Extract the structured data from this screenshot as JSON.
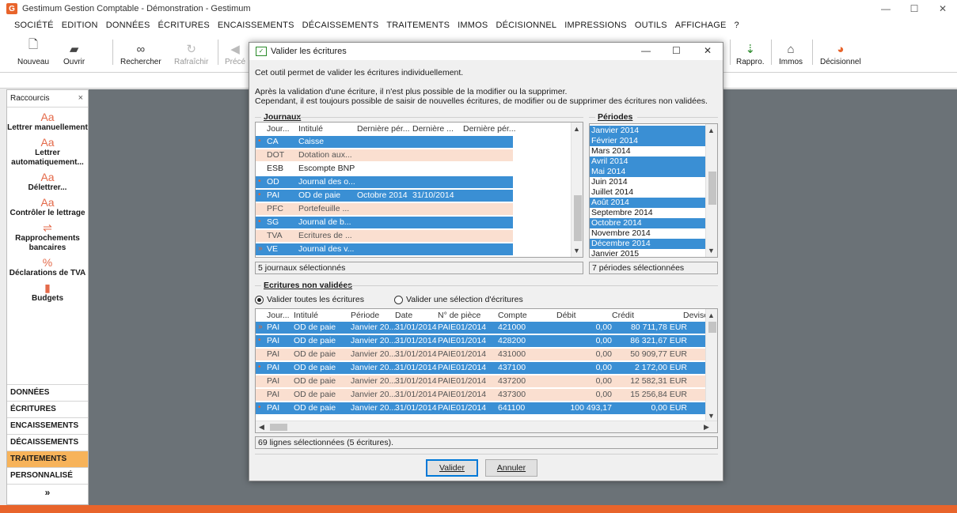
{
  "app": {
    "title": "Gestimum Gestion Comptable - Démonstration - Gestimum",
    "logo_letter": "G"
  },
  "window_controls": {
    "minimize": "—",
    "maximize": "☐",
    "close": "✕"
  },
  "menu": [
    "SOCIÉTÉ",
    "EDITION",
    "DONNÉES",
    "ÉCRITURES",
    "ENCAISSEMENTS",
    "DÉCAISSEMENTS",
    "TRAITEMENTS",
    "IMMOS",
    "DÉCISIONNEL",
    "IMPRESSIONS",
    "OUTILS",
    "AFFICHAGE",
    "?"
  ],
  "toolbar": {
    "nouveau": "Nouveau",
    "ouvrir": "Ouvrir",
    "rechercher": "Rechercher",
    "rafraichir": "Rafraîchir",
    "precedent": "Précé",
    "rappro": "Rappro.",
    "immos": "Immos",
    "decisionnel": "Décisionnel"
  },
  "left_panel": {
    "header": "Raccourcis",
    "close": "×",
    "shortcuts": [
      {
        "label": "Lettrer manuellement",
        "icon": "Aa"
      },
      {
        "label": "Lettrer automatiquement...",
        "icon": "Aa"
      },
      {
        "label": "Délettrer...",
        "icon": "Aa"
      },
      {
        "label": "Contrôler le lettrage",
        "icon": "Aa"
      },
      {
        "label": "Rapprochements bancaires",
        "icon": "⇌"
      },
      {
        "label": "Déclarations de TVA",
        "icon": "%"
      },
      {
        "label": "Budgets",
        "icon": "▮"
      }
    ],
    "nav": [
      "DONNÉES",
      "ÉCRITURES",
      "ENCAISSEMENTS",
      "DÉCAISSEMENTS",
      "TRAITEMENTS",
      "PERSONNALISÉ"
    ],
    "active_nav": "TRAITEMENTS",
    "more": "»"
  },
  "dialog": {
    "title": "Valider les écritures",
    "intro1": "Cet outil permet de valider les écritures individuellement.",
    "intro2": "Après la validation d'une écriture, il n'est plus possible de la modifier ou la supprimer.",
    "intro3": "Cependant, il est toujours possible de saisir de nouvelles écritures, de modifier ou de supprimer des écritures non validées.",
    "journaux": {
      "title": "Journaux",
      "columns": [
        "Jour...",
        "Intitulé",
        "Dernière pér...",
        "Dernière ...",
        "Dernière pér..."
      ],
      "rows": [
        {
          "code": "CA",
          "label": "Caisse",
          "p1": "",
          "p2": "",
          "state": "sel",
          "dot": "•"
        },
        {
          "code": "DOT",
          "label": "Dotation aux...",
          "p1": "",
          "p2": "",
          "state": "pink",
          "dot": ""
        },
        {
          "code": "ESB",
          "label": "Escompte BNP",
          "p1": "",
          "p2": "",
          "state": "white",
          "dot": ""
        },
        {
          "code": "OD",
          "label": "Journal des o...",
          "p1": "",
          "p2": "",
          "state": "sel",
          "dot": "•"
        },
        {
          "code": "PAI",
          "label": "OD de paie",
          "p1": "Octobre 2014",
          "p2": "31/10/2014",
          "state": "sel",
          "dot": "•"
        },
        {
          "code": "PFC",
          "label": "Portefeuille ...",
          "p1": "",
          "p2": "",
          "state": "pink",
          "dot": ""
        },
        {
          "code": "SG",
          "label": "Journal de b...",
          "p1": "",
          "p2": "",
          "state": "sel",
          "dot": "•"
        },
        {
          "code": "TVA",
          "label": "Ecritures de ...",
          "p1": "",
          "p2": "",
          "state": "pink",
          "dot": ""
        },
        {
          "code": "VE",
          "label": "Journal des v...",
          "p1": "",
          "p2": "",
          "state": "sel",
          "dot": "»"
        }
      ],
      "count": "5 journaux sélectionnés"
    },
    "periodes": {
      "title": "Périodes",
      "rows": [
        {
          "label": "Janvier 2014",
          "state": "sel"
        },
        {
          "label": "Février 2014",
          "state": "sel"
        },
        {
          "label": "Mars 2014",
          "state": "white"
        },
        {
          "label": "Avril 2014",
          "state": "sel"
        },
        {
          "label": "Mai 2014",
          "state": "sel"
        },
        {
          "label": "Juin 2014",
          "state": "white"
        },
        {
          "label": "Juillet 2014",
          "state": "white"
        },
        {
          "label": "Août 2014",
          "state": "sel"
        },
        {
          "label": "Septembre 2014",
          "state": "white"
        },
        {
          "label": "Octobre 2014",
          "state": "sel"
        },
        {
          "label": "Novembre 2014",
          "state": "white"
        },
        {
          "label": "Décembre 2014",
          "state": "sel"
        },
        {
          "label": "Janvier 2015",
          "state": "white"
        }
      ],
      "count": "7 périodes sélectionnées"
    },
    "ecritures": {
      "title": "Ecritures non validées",
      "radio_all": "Valider toutes les écritures",
      "radio_selection": "Valider une sélection d'écritures",
      "columns": [
        "Jour...",
        "Intitulé",
        "Période",
        "Date",
        "N° de pièce",
        "Compte",
        "Débit",
        "Crédit",
        "Devise"
      ],
      "rows": [
        {
          "dot": "»",
          "j": "PAI",
          "intitule": "OD de paie",
          "periode": "Janvier 20...",
          "date": "31/01/2014",
          "piece": "PAIE01/2014",
          "compte": "421000",
          "debit": "0,00",
          "credit": "80 711,78 EUR",
          "state": "sel"
        },
        {
          "dot": "•",
          "j": "PAI",
          "intitule": "OD de paie",
          "periode": "Janvier 20...",
          "date": "31/01/2014",
          "piece": "PAIE01/2014",
          "compte": "428200",
          "debit": "0,00",
          "credit": "86 321,67 EUR",
          "state": "sel"
        },
        {
          "dot": "",
          "j": "PAI",
          "intitule": "OD de paie",
          "periode": "Janvier 20...",
          "date": "31/01/2014",
          "piece": "PAIE01/2014",
          "compte": "431000",
          "debit": "0,00",
          "credit": "50 909,77 EUR",
          "state": "pink"
        },
        {
          "dot": "•",
          "j": "PAI",
          "intitule": "OD de paie",
          "periode": "Janvier 20...",
          "date": "31/01/2014",
          "piece": "PAIE01/2014",
          "compte": "437100",
          "debit": "0,00",
          "credit": "2 172,00 EUR",
          "state": "sel"
        },
        {
          "dot": "",
          "j": "PAI",
          "intitule": "OD de paie",
          "periode": "Janvier 20...",
          "date": "31/01/2014",
          "piece": "PAIE01/2014",
          "compte": "437200",
          "debit": "0,00",
          "credit": "12 582,31 EUR",
          "state": "pink"
        },
        {
          "dot": "",
          "j": "PAI",
          "intitule": "OD de paie",
          "periode": "Janvier 20...",
          "date": "31/01/2014",
          "piece": "PAIE01/2014",
          "compte": "437300",
          "debit": "0,00",
          "credit": "15 256,84 EUR",
          "state": "pink"
        },
        {
          "dot": "•",
          "j": "PAI",
          "intitule": "OD de paie",
          "periode": "Janvier 20...",
          "date": "31/01/2014",
          "piece": "PAIE01/2014",
          "compte": "641100",
          "debit": "100 493,17",
          "credit": "0,00 EUR",
          "state": "sel"
        }
      ],
      "count": "69 lignes sélectionnées (5 écritures)."
    },
    "buttons": {
      "valider": "Valider",
      "annuler": "Annuler"
    }
  },
  "colors": {
    "accent": "#e8642b",
    "selection": "#3a8fd4",
    "pink_row": "#fadfd0",
    "workarea": "#6b7277",
    "active_nav": "#f7b35a"
  }
}
